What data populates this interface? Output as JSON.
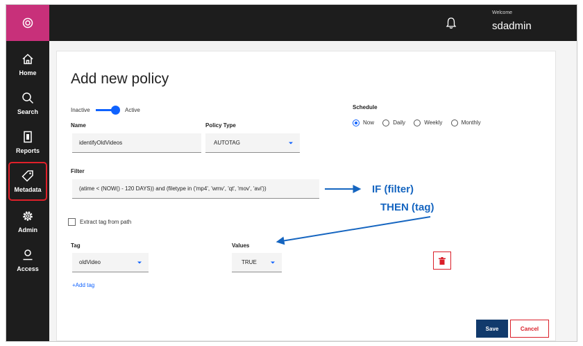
{
  "header": {
    "welcome": "Welcome",
    "user": "sdadmin"
  },
  "sidebar": {
    "items": [
      {
        "label": "Home",
        "icon": "home-icon"
      },
      {
        "label": "Search",
        "icon": "search-icon"
      },
      {
        "label": "Reports",
        "icon": "reports-icon"
      },
      {
        "label": "Metadata",
        "icon": "tag-icon",
        "selected": true
      },
      {
        "label": "Admin",
        "icon": "gear-icon"
      },
      {
        "label": "Access",
        "icon": "user-icon"
      }
    ]
  },
  "form": {
    "title": "Add new policy",
    "toggle": {
      "inactive": "Inactive",
      "active": "Active",
      "state": "Active"
    },
    "name_label": "Name",
    "name_value": "identifyOldVideos",
    "policy_type_label": "Policy Type",
    "policy_type_value": "AUTOTAG",
    "schedule_label": "Schedule",
    "schedule_options": [
      "Now",
      "Daily",
      "Weekly",
      "Monthly"
    ],
    "schedule_selected": "Now",
    "filter_label": "Filter",
    "filter_value": "(atime < (NOW() - 120 DAYS)) and (filetype in ('mp4', 'wmv', 'qt', 'mov', 'avi'))",
    "extract_label": "Extract tag from path",
    "tag_label": "Tag",
    "tag_value": "oldVideo",
    "values_label": "Values",
    "values_value": "TRUE",
    "add_tag": "+Add tag",
    "save": "Save",
    "cancel": "Cancel"
  },
  "annotations": {
    "line1": "IF (filter)",
    "line2": "THEN (tag)"
  },
  "colors": {
    "accent": "#0f62fe",
    "brand": "#c8307a",
    "danger": "#da1e28",
    "annotation": "#1565c0",
    "save": "#113a6c"
  }
}
